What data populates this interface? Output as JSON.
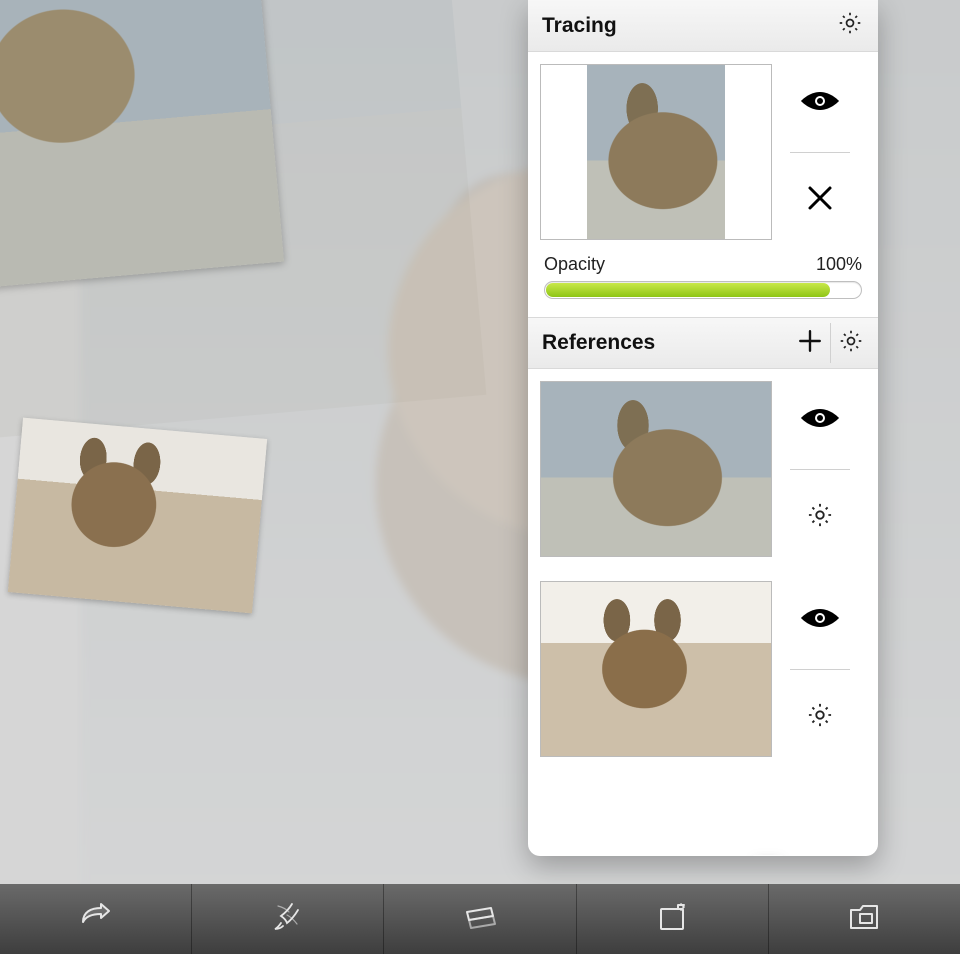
{
  "panel": {
    "tracing": {
      "title": "Tracing",
      "opacity_label": "Opacity",
      "opacity_value": "100%",
      "opacity_percent": 90
    },
    "references": {
      "title": "References"
    }
  },
  "icons": {
    "gear": "gear-icon",
    "plus": "plus-icon",
    "eye": "eye-icon",
    "close": "close-icon"
  },
  "toolbar": {
    "items": [
      "share",
      "brush",
      "layers",
      "image-panel",
      "gallery"
    ]
  }
}
